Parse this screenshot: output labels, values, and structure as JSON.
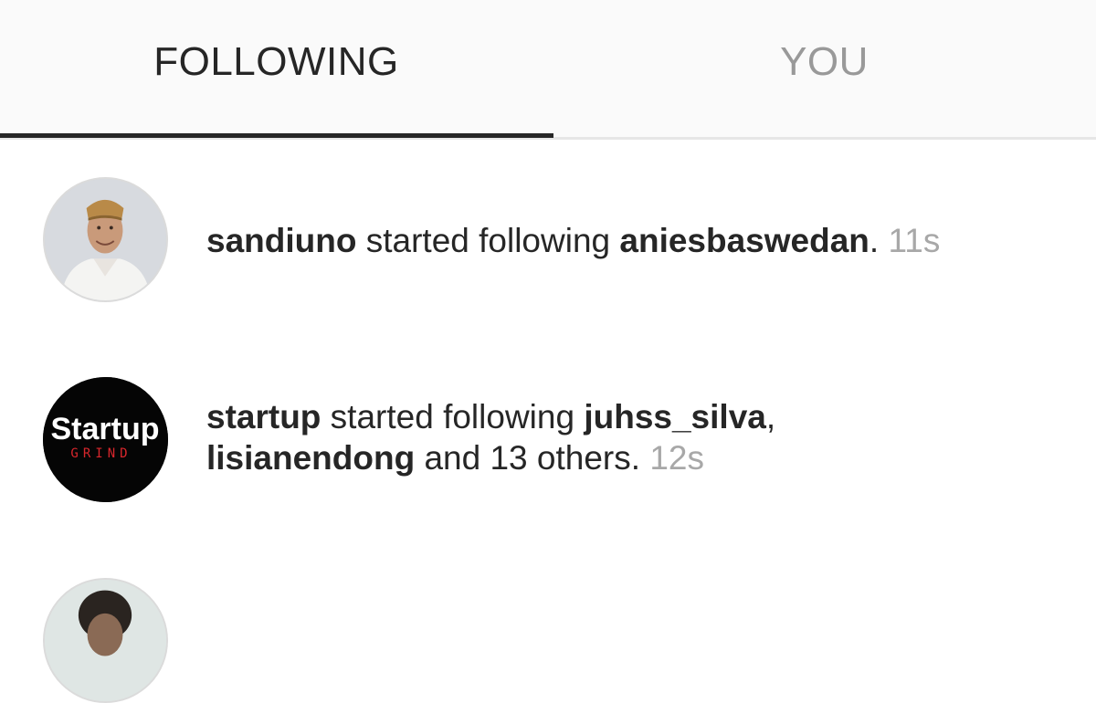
{
  "tabs": {
    "following": "FOLLOWING",
    "you": "YOU",
    "active": "following"
  },
  "feed": [
    {
      "user": "sandiuno",
      "action": " started following ",
      "target1": "aniesbaswedan",
      "after1": ".",
      "time": "11s"
    },
    {
      "user": "startup",
      "action": " started following ",
      "target1": "juhss_silva",
      "sep": ",",
      "target2": "lisianendong",
      "tail": " and 13 others.",
      "time": "12s",
      "logo_line1": "Startup",
      "logo_line2": "GRIND"
    }
  ],
  "colors": {
    "tab_bg": "#fafafa",
    "active_tab_text": "#262626",
    "inactive_tab_text": "#999999",
    "timestamp": "#a8a8a8",
    "indicator": "#262626"
  },
  "icons": {
    "avatar1": "profile-photo-man-in-peci",
    "avatar2": "startup-grind-logo",
    "avatar3": "profile-photo-partial"
  }
}
